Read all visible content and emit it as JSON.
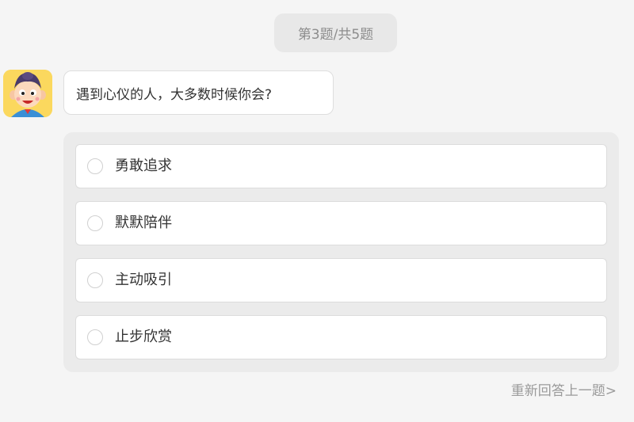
{
  "progress": {
    "text": "第3题/共5题"
  },
  "question": {
    "text": "遇到心仪的人，大多数时候你会?"
  },
  "options": [
    {
      "label": "勇敢追求"
    },
    {
      "label": "默默陪伴"
    },
    {
      "label": "主动吸引"
    },
    {
      "label": "止步欣赏"
    }
  ],
  "footer": {
    "redo_label": "重新回答上一题>"
  },
  "colors": {
    "page_background": "#f5f5f5",
    "avatar_background": "#fbd85e",
    "text_primary": "#333333",
    "text_muted": "#9a9a9a"
  },
  "icons": {
    "avatar": "cartoon-boy-avatar",
    "option_marker": "radio-circle-icon"
  }
}
